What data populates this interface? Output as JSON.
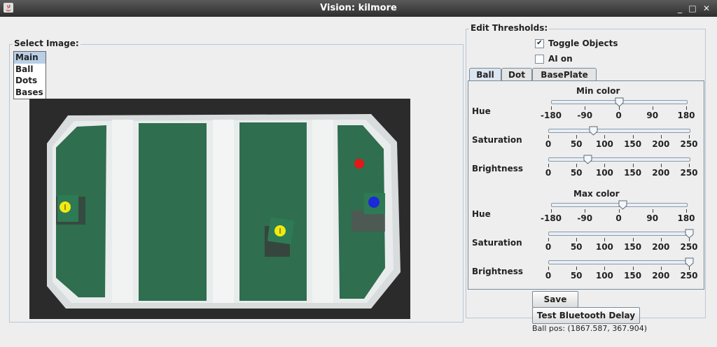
{
  "window": {
    "title": "Vision: kilmore",
    "minimize": "_",
    "maximize": "□",
    "close": "✕"
  },
  "select_image": {
    "legend": "Select Image:",
    "items": [
      {
        "label": "Main",
        "selected": true
      },
      {
        "label": "Ball",
        "selected": false
      },
      {
        "label": "Dots",
        "selected": false
      },
      {
        "label": "Bases",
        "selected": false
      }
    ]
  },
  "thresholds": {
    "legend": "Edit Thresholds:",
    "toggle_objects": {
      "label": "Toggle Objects",
      "checked": true
    },
    "ai_on": {
      "label": "AI on",
      "checked": false
    },
    "tabs": [
      {
        "label": "Ball",
        "active": true
      },
      {
        "label": "Dot",
        "active": false
      },
      {
        "label": "BasePlate",
        "active": false
      }
    ],
    "min_color": {
      "title": "Min color",
      "hue": {
        "label": "Hue",
        "value": 0,
        "min": -180,
        "max": 180,
        "ticks": [
          "-180",
          "-90",
          "0",
          "90",
          "180"
        ]
      },
      "saturation": {
        "label": "Saturation",
        "value": 80,
        "min": 0,
        "max": 250,
        "ticks": [
          "0",
          "50",
          "100",
          "150",
          "200",
          "250"
        ]
      },
      "brightness": {
        "label": "Brightness",
        "value": 70,
        "min": 0,
        "max": 250,
        "ticks": [
          "0",
          "50",
          "100",
          "150",
          "200",
          "250"
        ]
      }
    },
    "max_color": {
      "title": "Max color",
      "hue": {
        "label": "Hue",
        "value": 10,
        "min": -180,
        "max": 180,
        "ticks": [
          "-180",
          "-90",
          "0",
          "90",
          "180"
        ]
      },
      "saturation": {
        "label": "Saturation",
        "value": 250,
        "min": 0,
        "max": 250,
        "ticks": [
          "0",
          "50",
          "100",
          "150",
          "200",
          "250"
        ]
      },
      "brightness": {
        "label": "Brightness",
        "value": 250,
        "min": 0,
        "max": 250,
        "ticks": [
          "0",
          "50",
          "100",
          "150",
          "200",
          "250"
        ]
      }
    }
  },
  "buttons": {
    "save": "Save",
    "test_bluetooth": "Test Bluetooth Delay"
  },
  "status": {
    "ball_pos": "Ball pos: (1867.587, 367.904)"
  },
  "colors": {
    "field_green": "#3a7a55",
    "field_white": "#e6e6e6",
    "ball_red": "#e01818",
    "marker_yellow": "#f2ea10",
    "marker_blue": "#1a2ad8",
    "selection": "#b8cfe5"
  }
}
